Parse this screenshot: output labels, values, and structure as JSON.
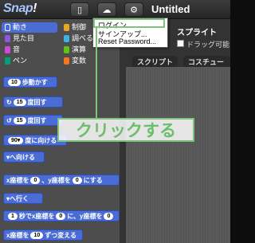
{
  "app": {
    "logo": "Snap!",
    "title": "Untitled"
  },
  "toolbar": {
    "file_icon": "file-icon",
    "cloud_icon": "cloud-icon",
    "gear_icon": "gear-icon"
  },
  "categories": [
    {
      "label": "動き",
      "color": "#4a6cd4",
      "selected": true
    },
    {
      "label": "制御",
      "color": "#e6a822"
    },
    {
      "label": "見た目",
      "color": "#8f56e3"
    },
    {
      "label": "調べる",
      "color": "#3ab4e0"
    },
    {
      "label": "音",
      "color": "#cf4ad9"
    },
    {
      "label": "演算",
      "color": "#62c213"
    },
    {
      "label": "ペン",
      "color": "#00a178"
    },
    {
      "label": "変数",
      "color": "#f3761d"
    }
  ],
  "blocks": {
    "move": {
      "pre": "",
      "num": "10",
      "post": "歩動かす"
    },
    "turn_cw": {
      "num": "15",
      "post": "度回す"
    },
    "turn_ccw": {
      "num": "15",
      "post": "度回す"
    },
    "point_dir": {
      "num": "90▾",
      "post": "度に向ける"
    },
    "point_towards": {
      "post": "へ向ける"
    },
    "goto_xy": {
      "pre": "x座標を",
      "n1": "0",
      "mid": "、y座標を",
      "n2": "0",
      "post": "にする"
    },
    "goto": {
      "post": "へ行く"
    },
    "glide": {
      "num1": "1",
      "mid": "秒でx座標を",
      "num2": "0",
      "mid2": "に、y座標を",
      "num3": "0"
    },
    "change_x": {
      "pre": "x座標を",
      "num": "10",
      "post": "ずつ変える"
    }
  },
  "right_panel": {
    "sprite_label": "スプライト",
    "draggable_label": "ドラッグ可能",
    "tabs": [
      "スクリプト",
      "コスチューム"
    ]
  },
  "menu": {
    "items": [
      "ログイン...",
      "サインアップ...",
      "Reset Password..."
    ]
  },
  "callout": {
    "text": "クリックする"
  },
  "colors": {
    "accent": "#4a6cd4",
    "highlight": "#7dc37d"
  }
}
